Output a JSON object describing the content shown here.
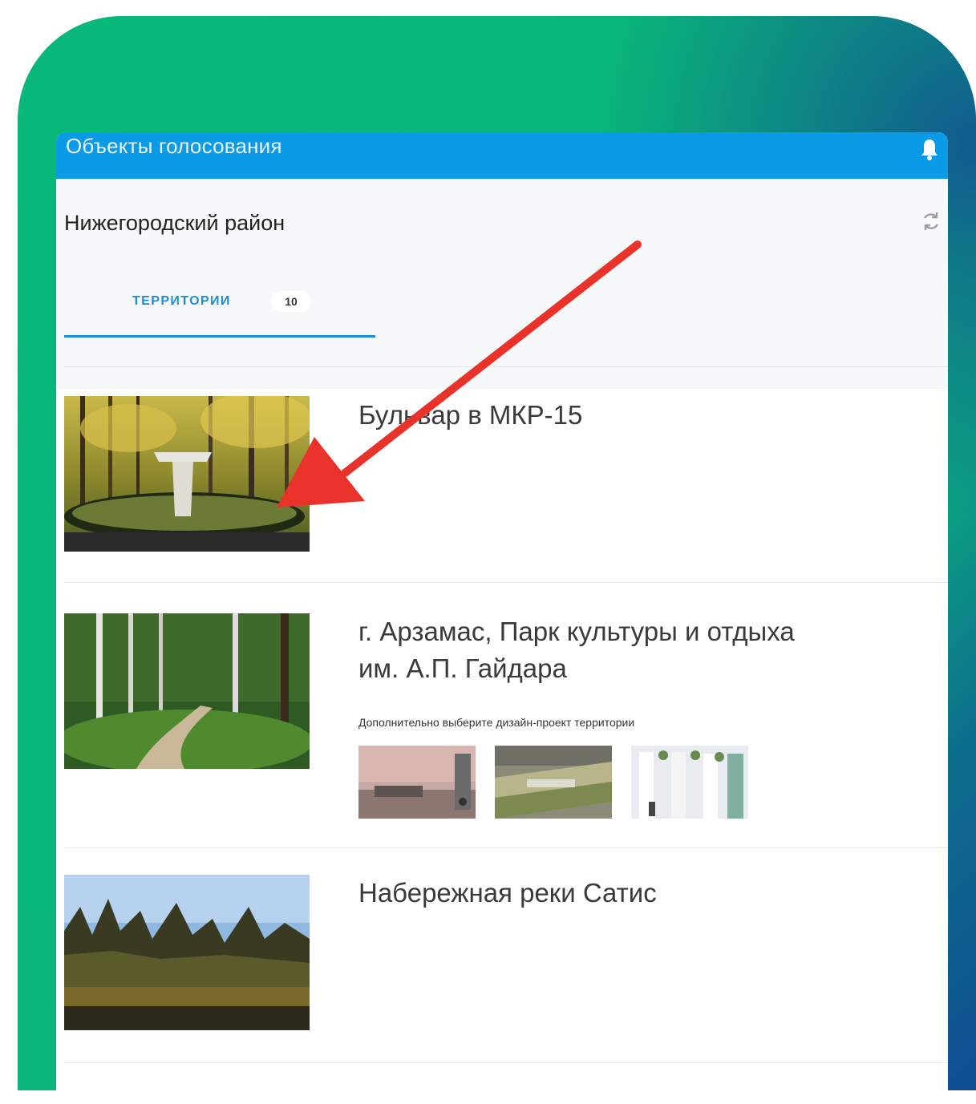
{
  "app": {
    "title": "Объекты голосования"
  },
  "header": {
    "district": "Нижегородский район"
  },
  "tabs": [
    {
      "label": "ТЕРРИТОРИИ",
      "count": "10",
      "active": true
    }
  ],
  "items": [
    {
      "title": "Бульвар в МКР-15"
    },
    {
      "title_line1": "г. Арзамас, Парк культуры и отдыха",
      "title_line2": "им. А.П. Гайдара",
      "hint": "Дополнительно выберите дизайн-проект территории",
      "design_projects": 3
    },
    {
      "title": "Набережная реки Сатис"
    }
  ],
  "colors": {
    "appbar": "#0a9ae6",
    "accent": "#1a8ed8",
    "frame_green": "#07b878",
    "frame_blue": "#0f4d92",
    "arrow": "#e8322a"
  },
  "icons": {
    "notifications": "bell-icon",
    "refresh": "refresh-icon"
  }
}
